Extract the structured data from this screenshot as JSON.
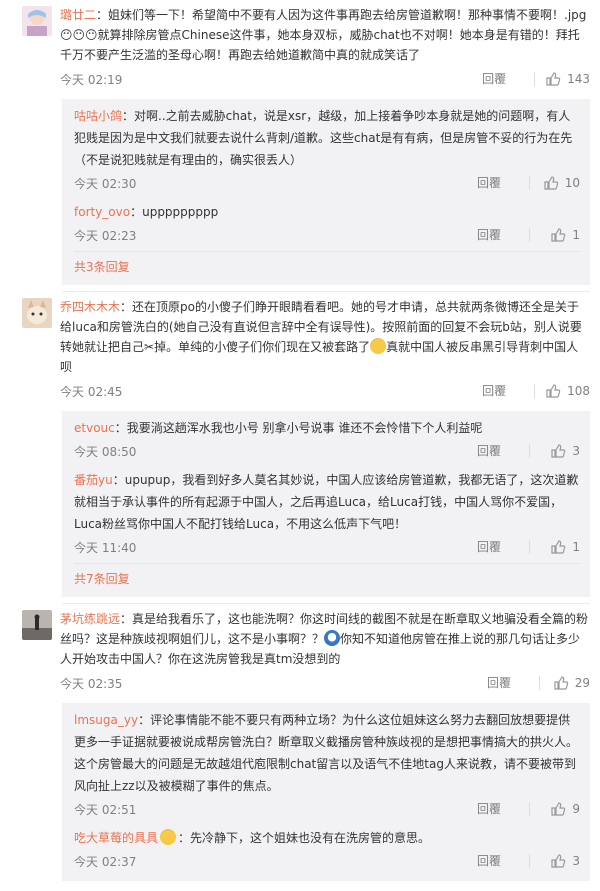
{
  "comments": [
    {
      "user": "璐廿二",
      "text": "：姐妹们等一下！希望简中不要有人因为这件事再跑去给房管道歉啊！那种事情不要啊！.jpg",
      "text2": "就算排除房管点Chinese这件事，她本身双标，威胁chat也不对啊！她本身是有错的！拜托千万不要产生泛滥的圣母心啊！再跑去给她道歉简中真的就成笑话了",
      "time": "今天 02:19",
      "reply_label": "回覆",
      "likes": "143",
      "replies": [
        {
          "user": "咕咕小鸽",
          "text": "：对啊..之前去威胁chat，说是xsr，越级，加上接着争吵本身就是她的问题啊，有人犯贱是因为是中文我们就要去说什么背刺/道歉。这些chat是有有病，但是房管不妥的行为在先（不是说犯贱就是有理由的，确实很丢人）",
          "time": "今天 02:30",
          "reply_label": "回覆",
          "likes": "10"
        },
        {
          "user": "forty_ovo",
          "text": "：uppppppppp",
          "time": "今天 02:23",
          "reply_label": "回覆",
          "likes": "1"
        }
      ],
      "more": "共3条回复"
    },
    {
      "user": "乔四木木木",
      "text": "：还在顶原po的小傻子们睁开眼睛看看吧。她的号才申请，总共就两条微博还全是关于给luca和房管洗白的(她自己没有直说但言辞中全有误导性)。按照前面的回复不会玩b站，别人说要转她就让把自己",
      "text2": "掉。单纯的小傻子们你们现在又被套路了",
      "text3": "真就中国人被反串黑引导背刺中国人呗",
      "time": "今天 02:45",
      "reply_label": "回覆",
      "likes": "108",
      "replies": [
        {
          "user": "etvouc",
          "text": "：我要淌这趟浑水我也小号 别拿小号说事 谁还不会怜惜下个人利益呢",
          "time": "今天 08:50",
          "reply_label": "回覆",
          "likes": "3"
        },
        {
          "user": "番茄yu",
          "text": "：upupup，我看到好多人莫名其妙说，中国人应该给房管道歉，我都无语了，这次道歉就相当于承认事件的所有起源于中国人，之后再追Luca，给Luca打钱，中国人骂你不爱国，Luca粉丝骂你中国人不配打钱给Luca，不用这么低声下气吧！",
          "time": "今天 11:40",
          "reply_label": "回覆",
          "likes": "1"
        }
      ],
      "more": "共7条回复"
    },
    {
      "user": "茅坑练跳远",
      "text": "：真是给我看乐了，这也能洗啊？你这时间线的截图不就是在断章取义地骗没看全篇的粉丝吗？这是种族歧视啊姐们儿，这不是小事啊？？",
      "text2": "你知不知道他房管在推上说的那几句话让多少人开始攻击中国人？你在这洗房管我是真tm没想到的",
      "time": "今天 02:35",
      "reply_label": "回覆",
      "likes": "29",
      "replies": [
        {
          "user": "lmsuga_yy",
          "text": "：评论事情能不能不要只有两种立场？为什么这位姐妹这么努力去翻回放想要提供更多一手证据就要被说成帮房管洗白？断章取义截播房管种族歧视的是想把事情搞大的拱火人。这个房管最大的问题是无故越俎代庖限制chat留言以及语气不佳地tag人来说教，请不要被带到风向扯上zz以及被模糊了事件的焦点。",
          "time": "今天 02:51",
          "reply_label": "回覆",
          "likes": "9"
        },
        {
          "user": "吃大草莓的具具",
          "text": "：先冷静下，这个姐妹也没有在洗房管的意思。",
          "time": "今天 02:37",
          "reply_label": "回覆",
          "likes": "3"
        }
      ]
    }
  ]
}
